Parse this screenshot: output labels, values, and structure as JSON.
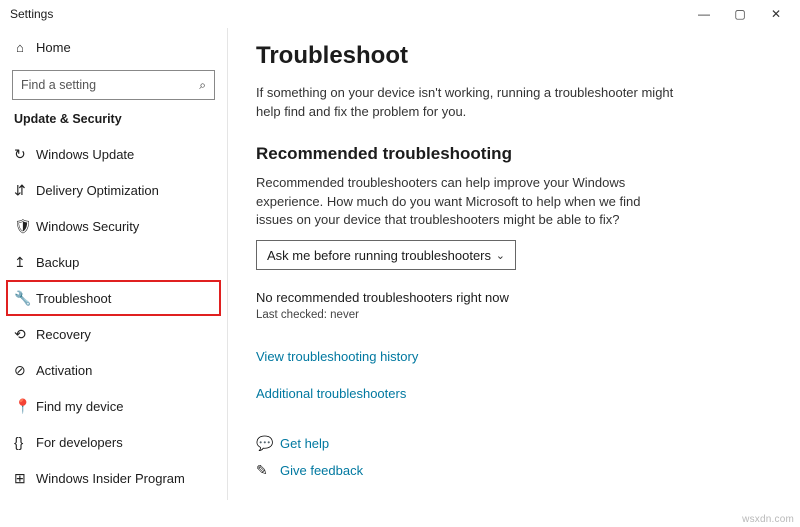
{
  "window_title": "Settings",
  "home_label": "Home",
  "search_placeholder": "Find a setting",
  "section_label": "Update & Security",
  "sidebar": {
    "items": [
      {
        "icon": "↻",
        "label": "Windows Update"
      },
      {
        "icon": "⇵",
        "label": "Delivery Optimization"
      },
      {
        "icon": "🛡",
        "label": "Windows Security"
      },
      {
        "icon": "↥",
        "label": "Backup"
      },
      {
        "icon": "🔧",
        "label": "Troubleshoot"
      },
      {
        "icon": "⟲",
        "label": "Recovery"
      },
      {
        "icon": "⊘",
        "label": "Activation"
      },
      {
        "icon": "📍",
        "label": "Find my device"
      },
      {
        "icon": "{}",
        "label": "For developers"
      },
      {
        "icon": "⊞",
        "label": "Windows Insider Program"
      }
    ]
  },
  "main": {
    "title": "Troubleshoot",
    "lead": "If something on your device isn't working, running a troubleshooter might help find and fix the problem for you.",
    "rec_heading": "Recommended troubleshooting",
    "rec_desc": "Recommended troubleshooters can help improve your Windows experience. How much do you want Microsoft to help when we find issues on your device that troubleshooters might be able to fix?",
    "dropdown_value": "Ask me before running troubleshooters",
    "status": "No recommended troubleshooters right now",
    "last_checked": "Last checked: never",
    "history_link": "View troubleshooting history",
    "additional_link": "Additional troubleshooters",
    "help_link": "Get help",
    "feedback_link": "Give feedback"
  },
  "watermark": "wsxdn.com"
}
